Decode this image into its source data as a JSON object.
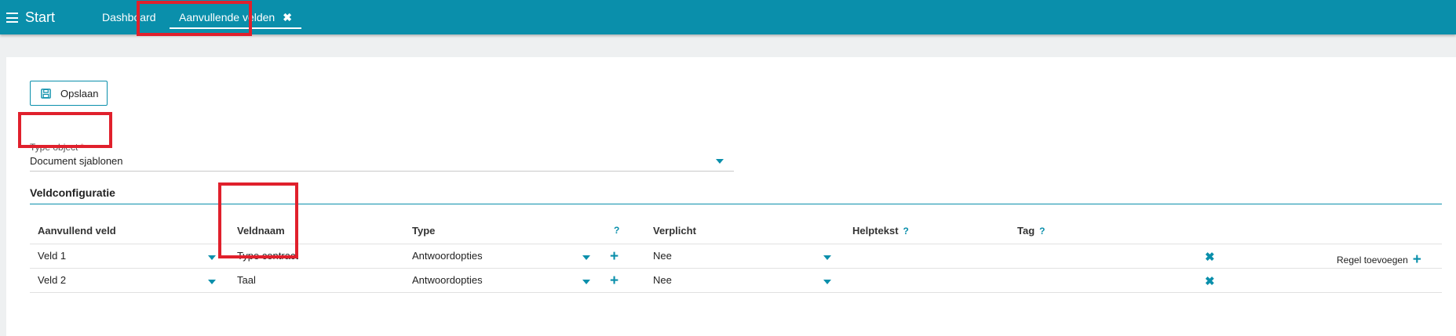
{
  "topbar": {
    "start_label": "Start",
    "tabs": [
      {
        "label": "Dashboard",
        "active": false
      },
      {
        "label": "Aanvullende velden",
        "active": true
      }
    ]
  },
  "toolbar": {
    "save_label": "Opslaan"
  },
  "type_object": {
    "label": "Type object",
    "required_mark": "*",
    "value": "Document sjablonen"
  },
  "section_title": "Veldconfiguratie",
  "grid": {
    "headers": {
      "aanvullend_veld": "Aanvullend veld",
      "veldnaam": "Veldnaam",
      "type": "Type",
      "type_help": "?",
      "verplicht": "Verplicht",
      "helptekst": "Helptekst",
      "helptekst_help": "?",
      "tag": "Tag",
      "tag_help": "?"
    },
    "rows": [
      {
        "aanvullend_veld": "Veld 1",
        "veldnaam": "Type contract",
        "type": "Antwoordopties",
        "verplicht": "Nee",
        "helptekst": "",
        "tag": ""
      },
      {
        "aanvullend_veld": "Veld 2",
        "veldnaam": "Taal",
        "type": "Antwoordopties",
        "verplicht": "Nee",
        "helptekst": "",
        "tag": ""
      }
    ],
    "add_row_label": "Regel toevoegen"
  },
  "colors": {
    "accent": "#0a8fab",
    "highlight": "#e0202c",
    "required": "#d32f2f"
  }
}
